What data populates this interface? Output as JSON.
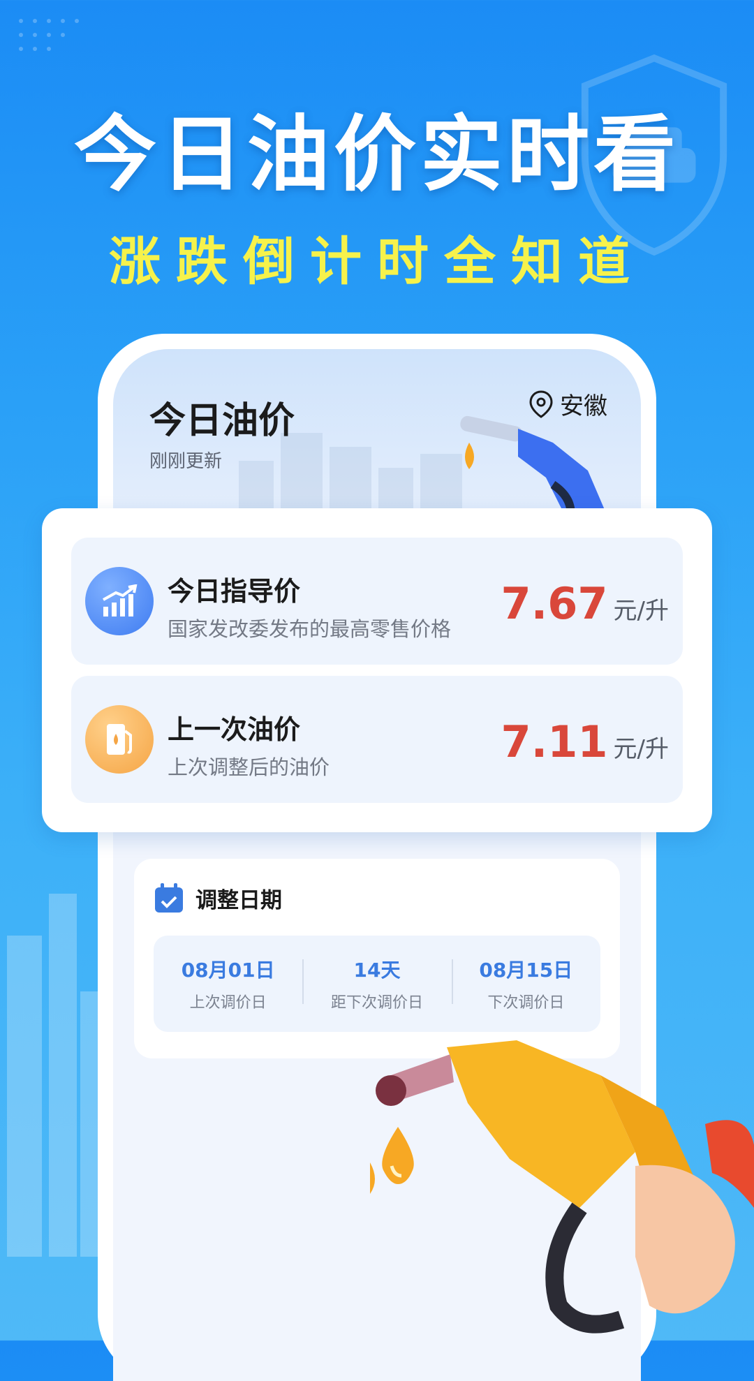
{
  "hero": {
    "title": "今日油价实时看",
    "subtitle": "涨跌倒计时全知道"
  },
  "screen": {
    "title": "今日油价",
    "updated": "刚刚更新",
    "location": "安徽"
  },
  "prices": [
    {
      "title": "今日指导价",
      "subtitle": "国家发改委发布的最高零售价格",
      "value": "7.67",
      "unit": "元/升",
      "icon": "trend-chart-icon",
      "accent": "#4a86f4"
    },
    {
      "title": "上一次油价",
      "subtitle": "上次调整后的油价",
      "value": "7.11",
      "unit": "元/升",
      "icon": "fuel-pump-icon",
      "accent": "#f5a545"
    }
  ],
  "adjust": {
    "title": "调整日期",
    "icon": "calendar-check-icon",
    "items": [
      {
        "value": "08月01日",
        "label": "上次调价日"
      },
      {
        "value": "14天",
        "label": "距下次调价日"
      },
      {
        "value": "08月15日",
        "label": "下次调价日"
      }
    ]
  },
  "colors": {
    "background": "#2aa0f7",
    "hero_subtitle": "#f6f24b",
    "price": "#d9473a",
    "link_blue": "#3a7be0"
  }
}
